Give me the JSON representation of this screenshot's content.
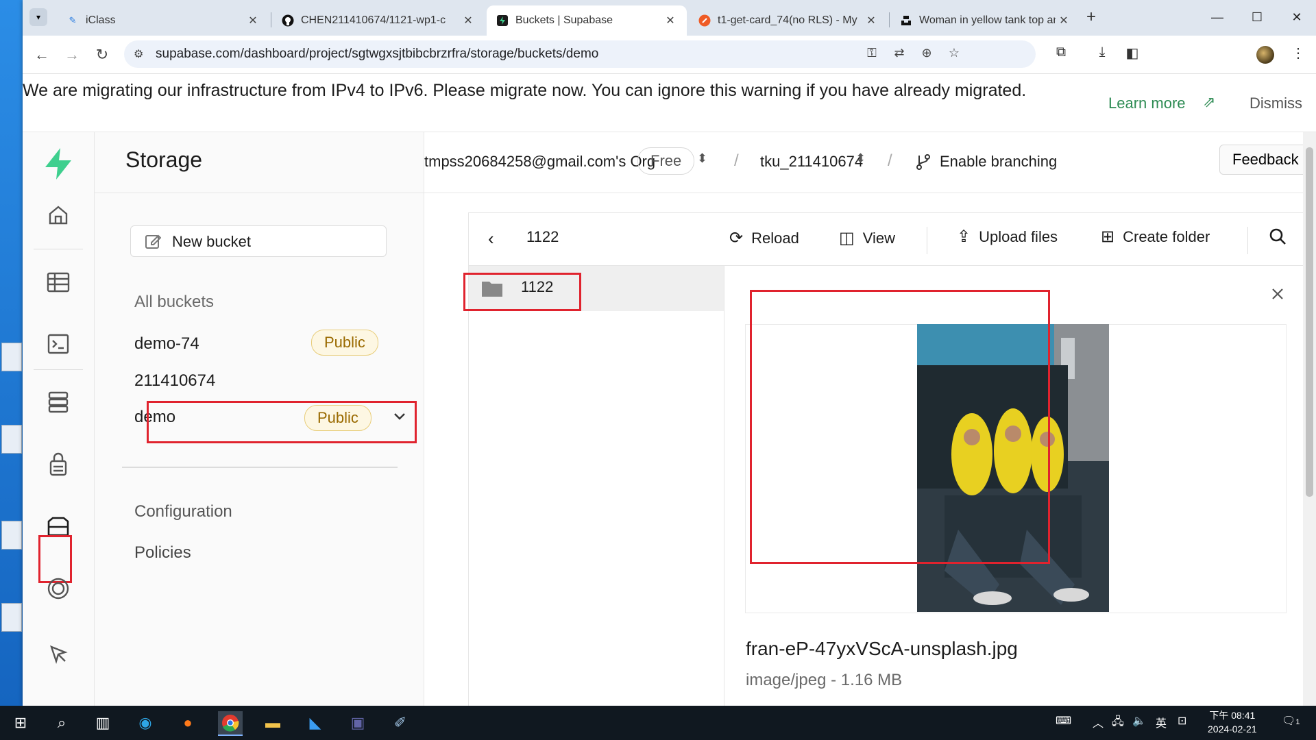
{
  "browser": {
    "tabs": [
      {
        "title": "iClass",
        "icon": "iclass-icon"
      },
      {
        "title": "CHEN211410674/1121-wp1-c",
        "icon": "github-icon"
      },
      {
        "title": "Buckets | Supabase",
        "icon": "supabase-icon",
        "active": true
      },
      {
        "title": "t1-get-card_74(no RLS) - My",
        "icon": "postman-icon"
      },
      {
        "title": "Woman in yellow tank top an",
        "icon": "unsplash-icon"
      }
    ],
    "url": "supabase.com/dashboard/project/sgtwgxsjtbibcbrzrfra/storage/buckets/demo"
  },
  "banner": {
    "message": "We are migrating our infrastructure from IPv4 to IPv6. Please migrate now. You can ignore this warning if you have already migrated.",
    "learn_more": "Learn more",
    "dismiss": "Dismiss"
  },
  "header": {
    "org": "tmpss20684258@gmail.com's Org",
    "plan": "Free",
    "project": "tku_211410674",
    "branching": "Enable branching",
    "feedback": "Feedback"
  },
  "storage": {
    "title": "Storage",
    "new_bucket": "New bucket",
    "all_buckets": "All buckets",
    "buckets": [
      {
        "name": "demo-74",
        "badge": "Public"
      },
      {
        "name": "211410674",
        "badge": ""
      },
      {
        "name": "demo",
        "badge": "Public"
      }
    ],
    "configuration": "Configuration",
    "policies": "Policies"
  },
  "explorer": {
    "path": "1122",
    "reload": "Reload",
    "view": "View",
    "upload": "Upload files",
    "create_folder": "Create folder",
    "folder": "1122",
    "preview": {
      "filename": "fran-eP-47yxVScA-unsplash.jpg",
      "meta": "image/jpeg - 1.16 MB"
    }
  },
  "taskbar": {
    "time": "下午 08:41",
    "date": "2024-02-21",
    "ime": "英",
    "notifications": "1"
  },
  "colors": {
    "accent": "#3ecf8e",
    "highlight": "#e0232e",
    "badge_bg": "#fdf7e3",
    "badge_text": "#9a6a00"
  }
}
